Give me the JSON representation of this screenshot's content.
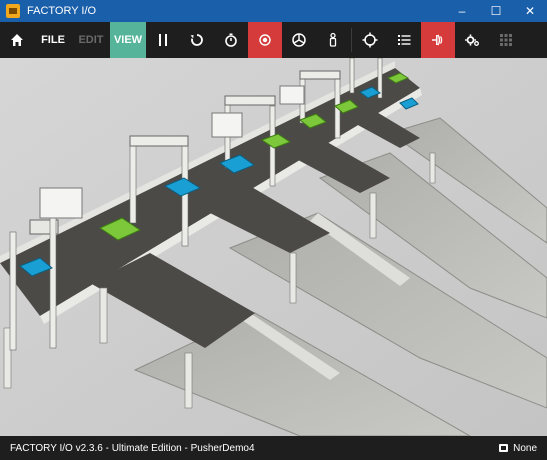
{
  "window": {
    "title": "FACTORY I/O",
    "minimize": "–",
    "maximize": "☐",
    "close": "✕"
  },
  "toolbar": {
    "file_label": "FILE",
    "edit_label": "EDIT",
    "view_label": "VIEW",
    "icons": [
      "home-icon",
      "pause-icon",
      "reset-icon",
      "timer-icon",
      "sensor-icon",
      "drive-icon",
      "person-icon",
      "crosshair-icon",
      "list-icon",
      "driver-icon",
      "settings-icon",
      "grid-icon"
    ],
    "accent_view": "#55b49a",
    "accent_red": "#d63b3b"
  },
  "status": {
    "text": "FACTORY I/O v2.3.6 - Ultimate Edition - PusherDemo4",
    "camera": "None"
  }
}
